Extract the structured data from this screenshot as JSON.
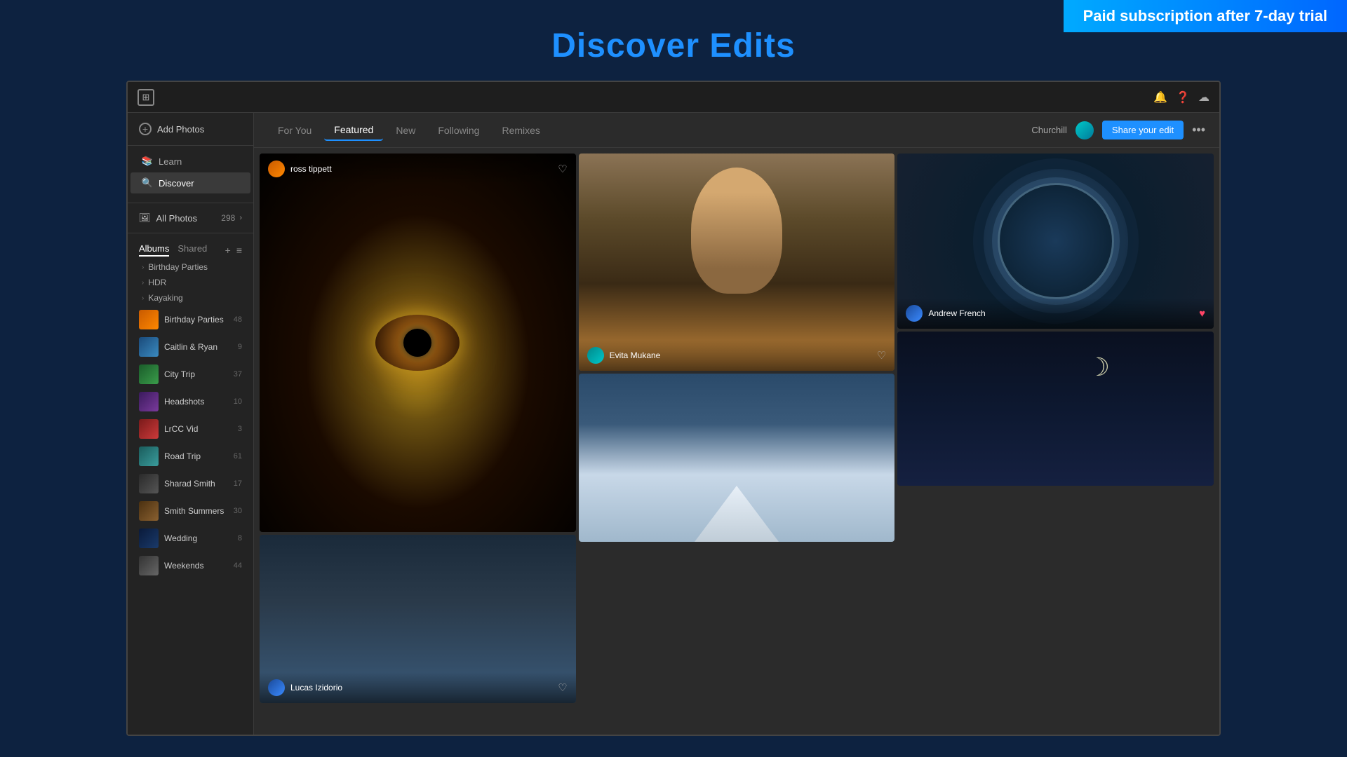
{
  "banner": {
    "text": "Paid subscription after 7-day trial"
  },
  "page_title": "Discover Edits",
  "titlebar": {
    "icon": "⊞"
  },
  "sidebar": {
    "add_photos": "Add Photos",
    "learn": "Learn",
    "discover": "Discover",
    "all_photos": "All Photos",
    "all_photos_count": "298",
    "albums_tab": "Albums",
    "shared_tab": "Shared",
    "album_groups": [
      {
        "name": "Birthday Parties"
      },
      {
        "name": "HDR"
      },
      {
        "name": "Kayaking"
      }
    ],
    "albums": [
      {
        "name": "Birthday Parties",
        "count": "48",
        "thumb": "orange"
      },
      {
        "name": "Caitlin & Ryan",
        "count": "9",
        "thumb": "blue"
      },
      {
        "name": "City Trip",
        "count": "37",
        "thumb": "green"
      },
      {
        "name": "Headshots",
        "count": "10",
        "thumb": "purple"
      },
      {
        "name": "LrCC Vid",
        "count": "3",
        "thumb": "red"
      },
      {
        "name": "Road Trip",
        "count": "61",
        "thumb": "teal"
      },
      {
        "name": "Sharad Smith",
        "count": "17",
        "thumb": "dark"
      },
      {
        "name": "Smith Summers",
        "count": "30",
        "thumb": "brown"
      },
      {
        "name": "Wedding",
        "count": "8",
        "thumb": "navy"
      },
      {
        "name": "Weekends",
        "count": "44",
        "thumb": "gray"
      }
    ]
  },
  "nav": {
    "tabs": [
      {
        "label": "For You",
        "active": false
      },
      {
        "label": "Featured",
        "active": true
      },
      {
        "label": "New",
        "active": false
      },
      {
        "label": "Following",
        "active": false
      },
      {
        "label": "Remixes",
        "active": false
      }
    ],
    "user_label": "Churchill",
    "share_button": "Share your edit",
    "more_icon": "•••"
  },
  "photos": {
    "col1": [
      {
        "id": "eye",
        "author": "ross tippett",
        "avatar": "orange",
        "liked": false
      },
      {
        "id": "landscape",
        "author": "Lucas Izidorio",
        "avatar": "blue",
        "liked": false
      }
    ],
    "col2": [
      {
        "id": "woman",
        "author": "Evita Mukane",
        "avatar": "teal",
        "liked": false
      },
      {
        "id": "snow",
        "author": "",
        "avatar": "",
        "liked": false
      }
    ],
    "col3": [
      {
        "id": "spiral",
        "author": "Andrew French",
        "avatar": "blue",
        "liked": false
      },
      {
        "id": "moon",
        "author": "",
        "avatar": "",
        "liked": false
      }
    ]
  }
}
